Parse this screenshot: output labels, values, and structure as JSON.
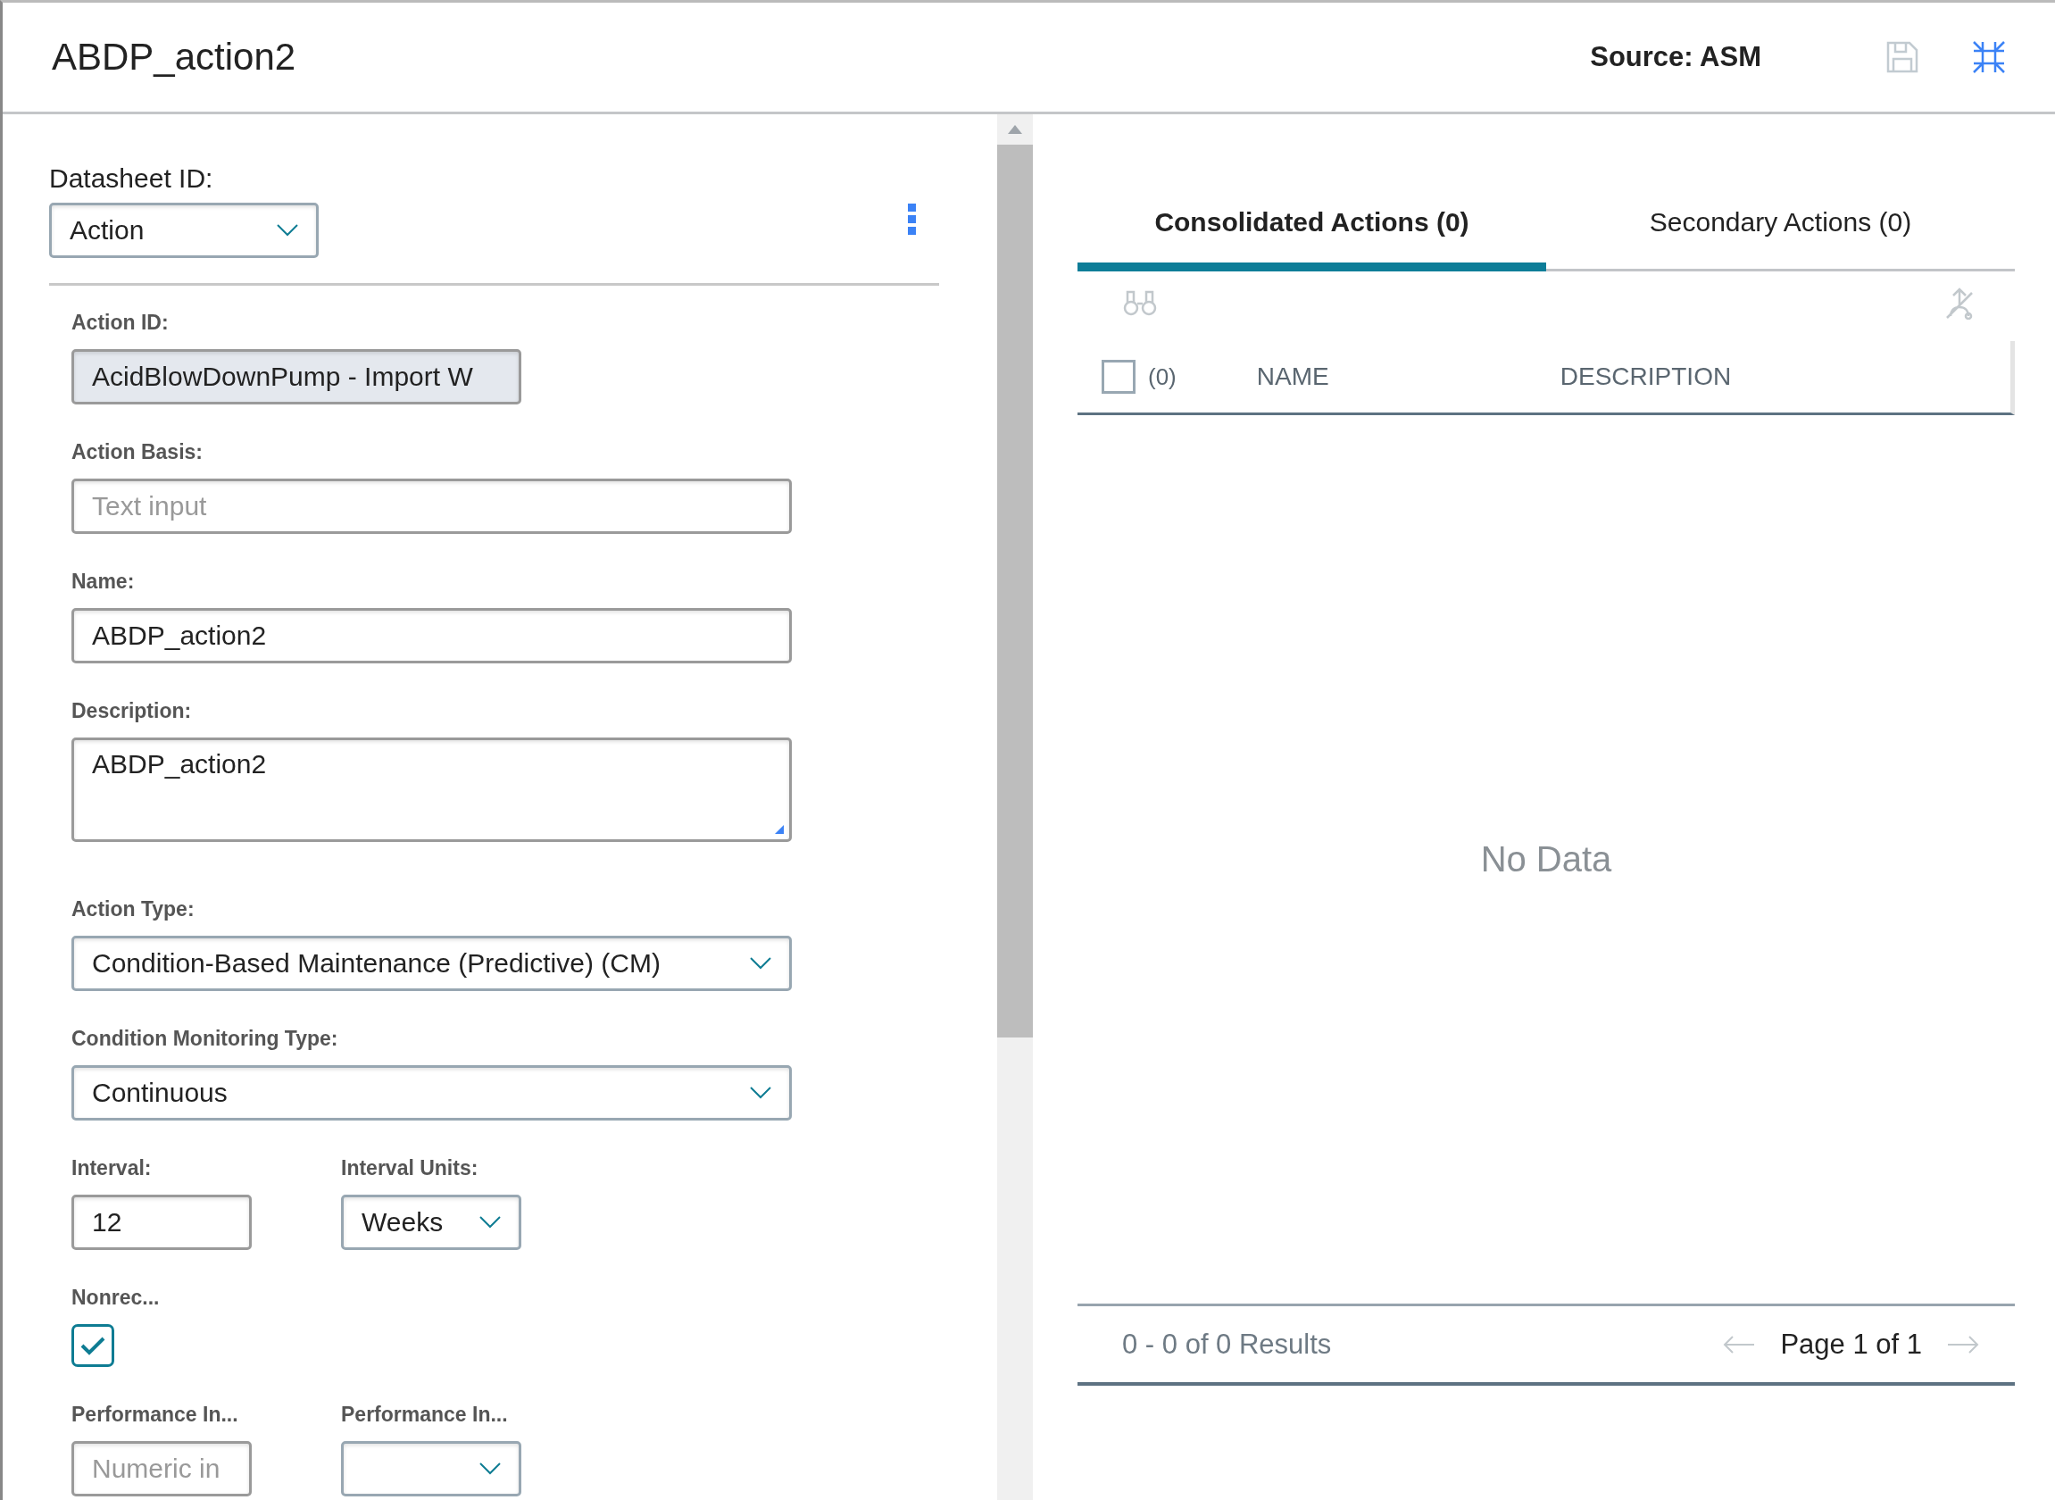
{
  "header": {
    "title": "ABDP_action2",
    "source": "Source: ASM"
  },
  "datasheet": {
    "label": "Datasheet ID:",
    "value": "Action"
  },
  "form_rows": [
    [
      {
        "kind": "text",
        "label": "Action ID:",
        "value": "AcidBlowDownPump - Import W",
        "disabled": true
      }
    ],
    [
      {
        "kind": "text",
        "label": "Action Basis:",
        "placeholder": "Text input",
        "disabled": false
      }
    ],
    [
      {
        "kind": "text",
        "label": "Name:",
        "value": "ABDP_action2",
        "disabled": false
      }
    ],
    [
      {
        "kind": "textarea",
        "label": "Description:",
        "value": "ABDP_action2"
      }
    ],
    [
      {
        "kind": "select",
        "label": "Action Type:",
        "value": "Condition-Based Maintenance (Predictive) (CM)"
      }
    ],
    [
      {
        "kind": "select",
        "label": "Condition Monitoring Type:",
        "value": "Continuous"
      }
    ],
    [
      {
        "kind": "text",
        "label": "Interval:",
        "value": "12",
        "disabled": false
      },
      {
        "kind": "select",
        "label": "Interval Units:",
        "value": "Weeks"
      }
    ],
    [
      {
        "kind": "checkbox",
        "label": "Nonrec...",
        "checked": true
      }
    ],
    [
      {
        "kind": "text",
        "label": "Performance In...",
        "placeholder": "Numeric in",
        "disabled": false
      },
      {
        "kind": "select",
        "label": "Performance In..."
      }
    ]
  ],
  "tabs": [
    {
      "label": "Consolidated Actions (0)",
      "selected": true
    },
    {
      "label": "Secondary Actions (0)",
      "selected": false
    }
  ],
  "table": {
    "select_count": "(0)",
    "all_checked": false,
    "columns": [
      "NAME",
      "DESCRIPTION"
    ],
    "empty": "No Data"
  },
  "pager": {
    "results": "0 - 0 of 0 Results",
    "page": "Page 1 of 1"
  }
}
